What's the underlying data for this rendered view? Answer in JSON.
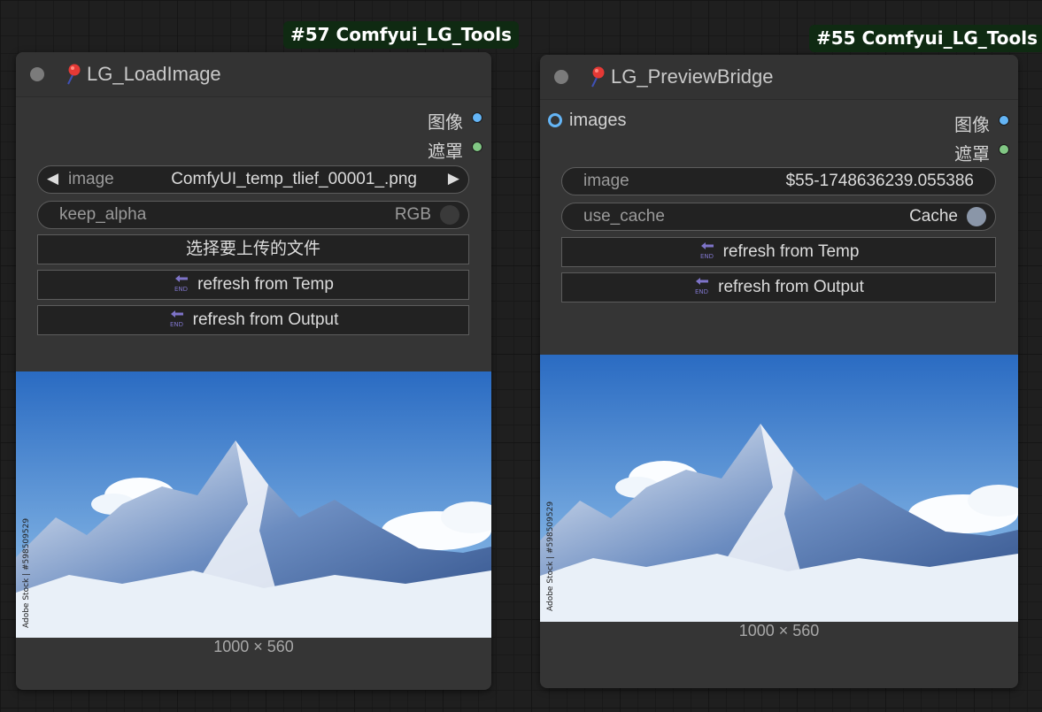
{
  "nodes": [
    {
      "id_label": "#57 Comfyui_LG_Tools",
      "title": "LG_LoadImage",
      "outputs": [
        "图像",
        "遮罩"
      ],
      "image_widget": {
        "label": "image",
        "value": "ComfyUI_temp_tlief_00001_.png"
      },
      "toggle_widget": {
        "label": "keep_alpha",
        "value": "RGB"
      },
      "upload_button": "选择要上传的文件",
      "refresh_temp": "refresh from Temp",
      "refresh_output": "refresh from Output",
      "preview_dims": "1000 × 560",
      "watermark": "Adobe Stock | #598509529"
    },
    {
      "id_label": "#55 Comfyui_LG_Tools",
      "title": "LG_PreviewBridge",
      "input": "images",
      "outputs": [
        "图像",
        "遮罩"
      ],
      "image_widget": {
        "label": "image",
        "value": "$55-1748636239.055386"
      },
      "toggle_widget": {
        "label": "use_cache",
        "value": "Cache"
      },
      "refresh_temp": "refresh from Temp",
      "refresh_output": "refresh from Output",
      "preview_dims": "1000 × 560",
      "watermark": "Adobe Stock | #598509529"
    }
  ],
  "icons": {
    "header_dot": "node-status-dot",
    "pin": "pin-icon",
    "refresh": "end-arrow-icon"
  },
  "colors": {
    "image_slot": "#64b5f6",
    "mask_slot": "#81c784",
    "badge_bg": "#0f2a12"
  }
}
